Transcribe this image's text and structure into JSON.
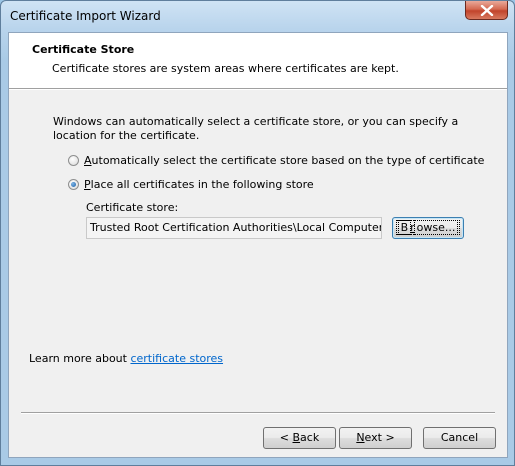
{
  "window": {
    "title": "Certificate Import Wizard",
    "close_icon": "close-icon"
  },
  "header": {
    "title": "Certificate Store",
    "subtitle": "Certificate stores are system areas where certificates are kept."
  },
  "intro": "Windows can automatically select a certificate store, or you can specify a location for the certificate.",
  "options": {
    "auto": {
      "mnemonic": "A",
      "rest": "utomatically select the certificate store based on the type of certificate",
      "checked": false
    },
    "place": {
      "mnemonic": "P",
      "rest": "lace all certificates in the following store",
      "checked": true
    }
  },
  "store": {
    "label": "Certificate store:",
    "value": "Trusted Root Certification Authorities\\Local Computer",
    "browse_mnemonic": "r",
    "browse_pre": "B",
    "browse_post": "owse..."
  },
  "learn_more": {
    "prefix": "Learn more about ",
    "link": "certificate stores"
  },
  "buttons": {
    "back_pre": "< ",
    "back_mnemonic": "B",
    "back_post": "ack",
    "next_mnemonic": "N",
    "next_post": "ext >",
    "cancel": "Cancel"
  },
  "colors": {
    "link": "#0066cc",
    "close_button": "#c1442b"
  }
}
